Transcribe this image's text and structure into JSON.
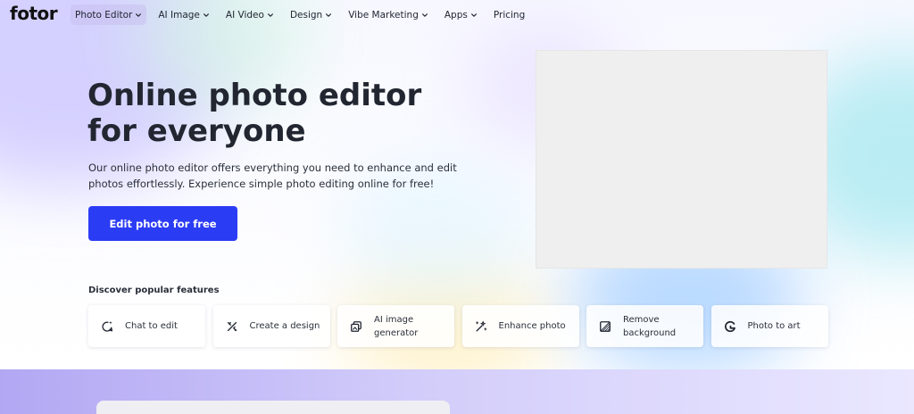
{
  "brand": {
    "logo_text": "fotor"
  },
  "nav": {
    "items": [
      {
        "label": "Photo Editor",
        "has_dropdown": true,
        "active": true
      },
      {
        "label": "AI Image",
        "has_dropdown": true
      },
      {
        "label": "AI Video",
        "has_dropdown": true
      },
      {
        "label": "Design",
        "has_dropdown": true
      },
      {
        "label": "Vibe Marketing",
        "has_dropdown": true
      },
      {
        "label": "Apps",
        "has_dropdown": true
      },
      {
        "label": "Pricing",
        "has_dropdown": false
      }
    ]
  },
  "hero": {
    "title": "Online photo editor for everyone",
    "description": "Our online photo editor offers everything you need to enhance and edit photos effortlessly. Experience simple photo editing online for free!",
    "cta_label": "Edit photo for free"
  },
  "features": {
    "heading": "Discover popular features",
    "items": [
      {
        "label": "Chat to edit",
        "icon": "chat-sparkle-icon"
      },
      {
        "label": "Create a design",
        "icon": "design-tools-icon"
      },
      {
        "label": "AI image generator",
        "icon": "ai-image-icon"
      },
      {
        "label": "Enhance photo",
        "icon": "magic-wand-icon"
      },
      {
        "label": "Remove background",
        "icon": "remove-background-icon"
      },
      {
        "label": "Photo to art",
        "icon": "photo-to-art-icon"
      }
    ]
  },
  "colors": {
    "accent": "#2b3cf5",
    "text": "#222631",
    "preview_bg": "#efefef"
  }
}
